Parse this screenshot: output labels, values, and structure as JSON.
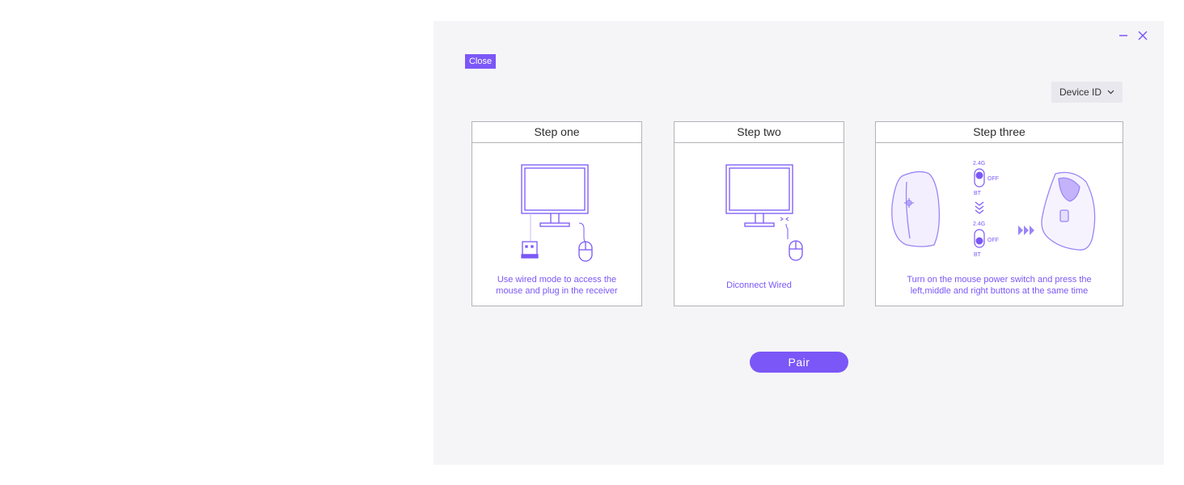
{
  "window": {
    "minimize_icon": "minus-icon",
    "close_icon": "x-icon"
  },
  "close_label": "Close",
  "device_select": {
    "label": "Device ID",
    "icon": "chevron-down-icon"
  },
  "steps": [
    {
      "title": "Step one",
      "description_line1": "Use wired mode to access the",
      "description_line2": "mouse and plug in the receiver"
    },
    {
      "title": "Step two",
      "description_line1": "Diconnect Wired"
    },
    {
      "title": "Step three",
      "description_line1": "Turn on the mouse power switch and press the",
      "description_line2": "left,middle and right buttons at the same time",
      "switch_labels": {
        "on_top": "2.4G",
        "off_top": "OFF",
        "bt_top": "BT",
        "on_bottom": "2.4G",
        "off_bottom": "OFF",
        "bt_bottom": "BT"
      }
    }
  ],
  "pair_label": "Pair",
  "colors": {
    "accent": "#7b57f7",
    "panel_bg": "#f5f5f7",
    "border": "#b3b3b8"
  }
}
